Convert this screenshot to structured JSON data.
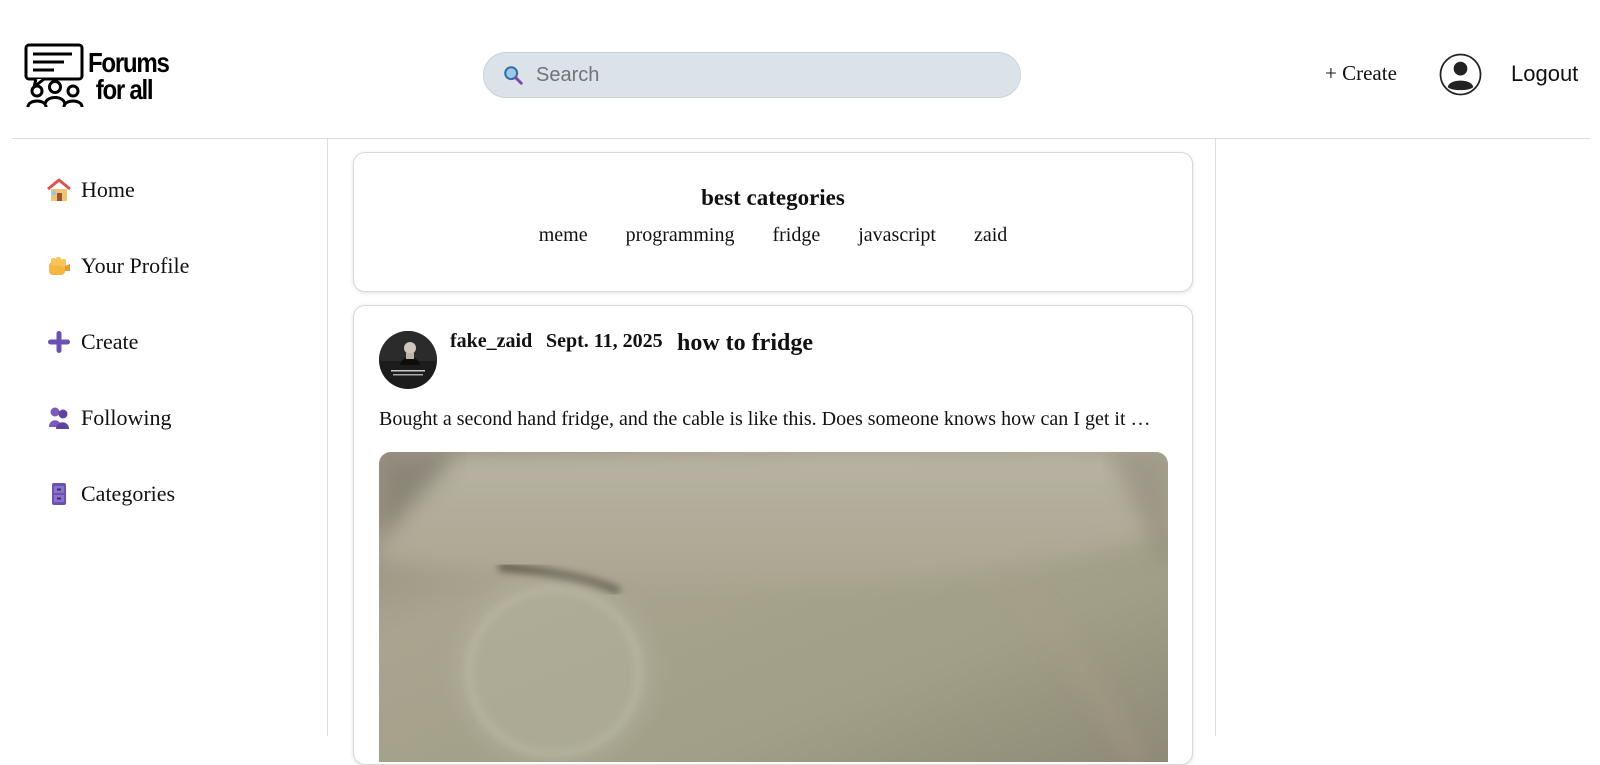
{
  "header": {
    "logo": {
      "line1": "Forums",
      "line2": "for all"
    },
    "search": {
      "placeholder": "Search"
    },
    "create_label": "+ Create",
    "logout_label": "Logout"
  },
  "sidebar": {
    "items": [
      {
        "label": "Home",
        "icon": "house-icon"
      },
      {
        "label": "Your Profile",
        "icon": "fist-icon"
      },
      {
        "label": "Create",
        "icon": "plus-icon"
      },
      {
        "label": "Following",
        "icon": "people-icon"
      },
      {
        "label": "Categories",
        "icon": "cabinet-icon"
      }
    ]
  },
  "categories_card": {
    "title": "best categories",
    "items": [
      "meme",
      "programming",
      "fridge",
      "javascript",
      "zaid"
    ]
  },
  "post": {
    "username": "fake_zaid",
    "date": "Sept. 11, 2025",
    "title": "how to fridge",
    "body": "Bought a second hand fridge, and the cable is like this. Does someone knows how can I get it …"
  },
  "colors": {
    "search_bg": "#dbe3e8",
    "divider": "#dcdcdc",
    "icon_purple": "#6b52b0"
  }
}
